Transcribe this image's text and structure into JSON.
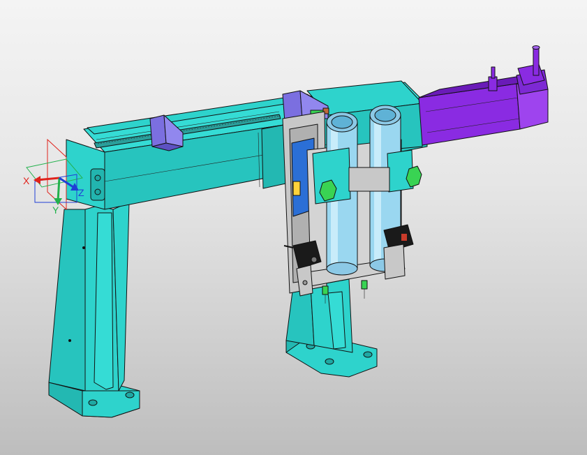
{
  "viewport": {
    "background": "#d8d8d8",
    "model_colors": {
      "frame": "#2ed3cc",
      "frame_dark": "#1fa8a3",
      "frame_shadow": "#178c87",
      "motor": "#8a2be2",
      "motor_dark": "#6a1bb8",
      "slider": "#7b6fe0",
      "plate": "#c8c8c8",
      "cylinder": "#9ad7f0",
      "cylinder_dark": "#5fb2d6",
      "fitting": "#39d353",
      "sensor": "#1a1a1a",
      "blue_block": "#2b6fd6"
    }
  },
  "triad": {
    "x_label": "X",
    "y_label": "Y",
    "z_label": "Z",
    "x_color": "#e0231c",
    "y_color": "#22b14c",
    "z_color": "#1f3fd6"
  }
}
